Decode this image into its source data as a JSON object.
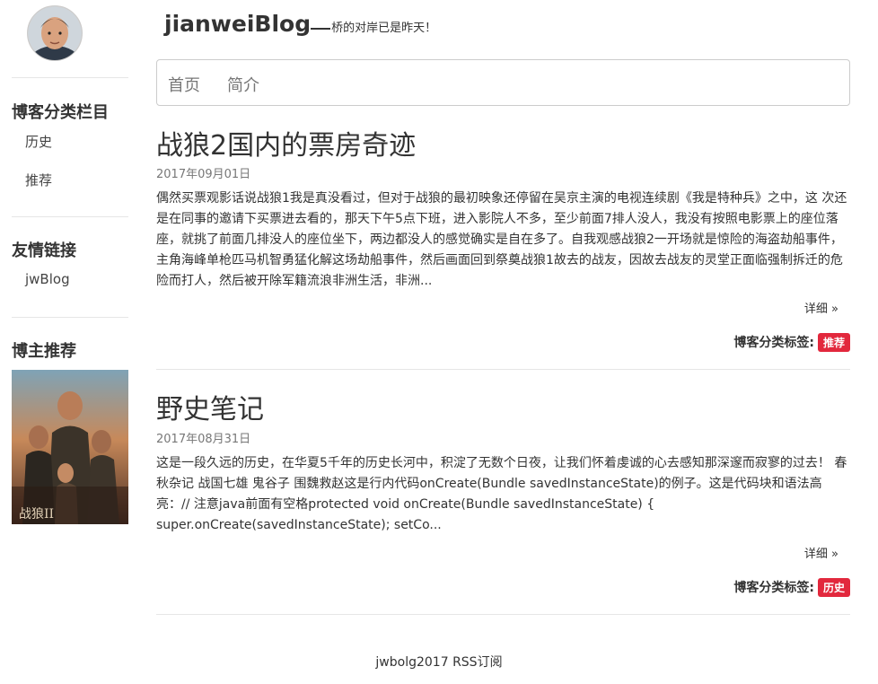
{
  "brand": {
    "name": "jianweiBlog",
    "tagline": "桥的对岸已是昨天！"
  },
  "nav": {
    "items": [
      {
        "label": "首页"
      },
      {
        "label": "简介"
      }
    ]
  },
  "sidebar": {
    "categories_heading": "博客分类栏目",
    "categories": [
      {
        "label": "历史"
      },
      {
        "label": "推荐"
      }
    ],
    "links_heading": "友情链接",
    "links": [
      {
        "label": "jwBlog"
      }
    ],
    "recommend_heading": "博主推荐"
  },
  "posts": [
    {
      "title": "战狼2国内的票房奇迹",
      "date": "2017年09月01日",
      "excerpt": "偶然买票观影话说战狼1我是真没看过，但对于战狼的最初映象还停留在吴京主演的电视连续剧《我是特种兵》之中，这 次还是在同事的邀请下买票进去看的，那天下午5点下班，进入影院人不多，至少前面7排人没人，我没有按照电影票上的座位落座，就挑了前面几排没人的座位坐下，两边都没人的感觉确实是自在多了。自我观感战狼2一开场就是惊险的海盗劫船事件，主角海峰单枪匹马机智勇猛化解这场劫船事件，然后画面回到祭奠战狼1故去的战友，因故去战友的灵堂正面临强制拆迁的危险而打人，然后被开除军籍流浪非洲生活，非洲...",
      "detail_label": "详细 »",
      "tag_label": "博客分类标签:",
      "tag": "推荐"
    },
    {
      "title": "野史笔记",
      "date": "2017年08月31日",
      "excerpt": "这是一段久远的历史，在华夏5千年的历史长河中，积淀了无数个日夜，让我们怀着虔诚的心去感知那深邃而寂寥的过去！ 春秋杂记 战国七雄 鬼谷子 围魏救赵这是行内代码onCreate(Bundle savedInstanceState)的例子。这是代码块和语法高亮：// 注意java前面有空格protected void onCreate(Bundle savedInstanceState) { super.onCreate(savedInstanceState); setCo...",
      "detail_label": "详细 »",
      "tag_label": "博客分类标签:",
      "tag": "历史"
    }
  ],
  "footer": {
    "text": "jwbolg2017 RSS订阅"
  },
  "colors": {
    "tag_badge": "#e2283d",
    "text": "#333333",
    "muted": "#777777"
  }
}
